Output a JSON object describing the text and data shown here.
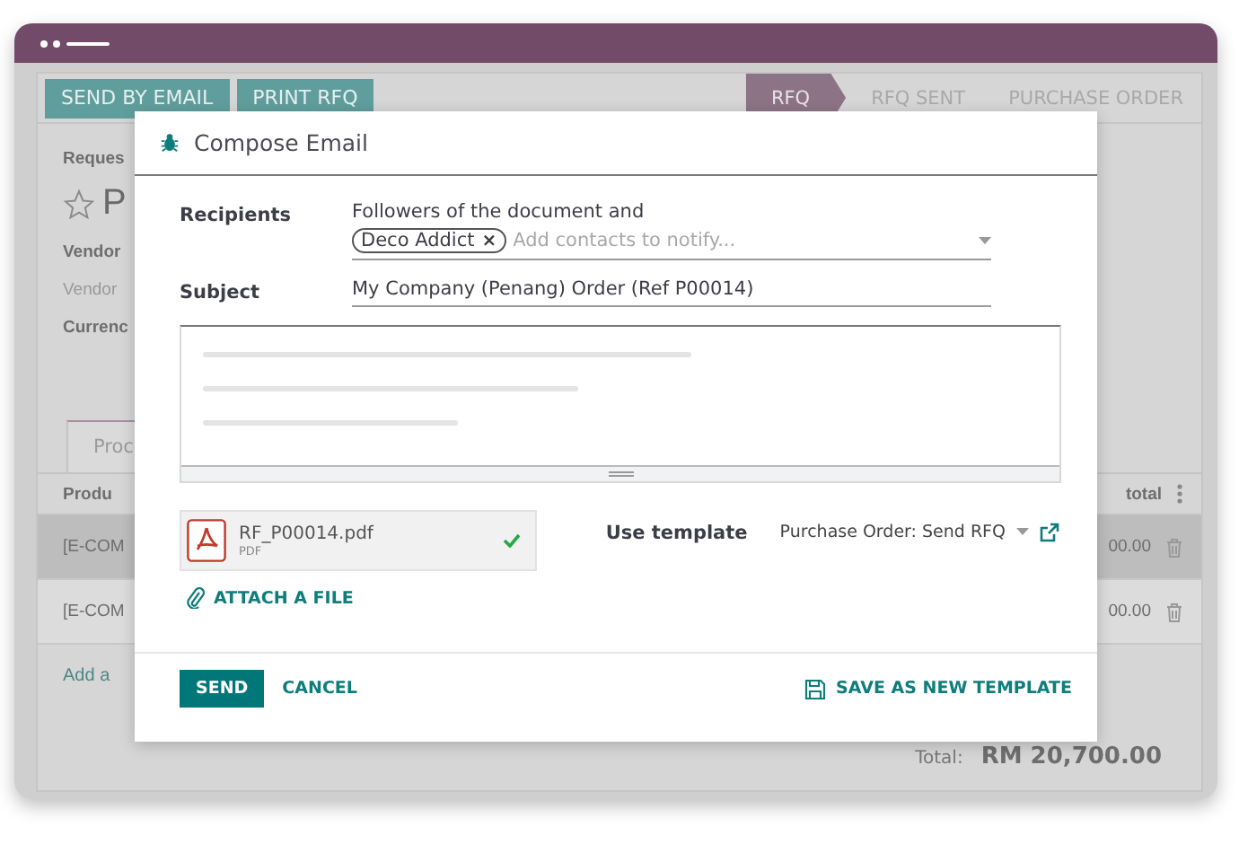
{
  "toolbar": {
    "buttons": [
      "SEND BY EMAIL",
      "PRINT RFQ"
    ]
  },
  "stages": [
    {
      "label": "RFQ",
      "selected": true
    },
    {
      "label": "RFQ SENT",
      "selected": false
    },
    {
      "label": "PURCHASE ORDER",
      "selected": false
    }
  ],
  "form": {
    "caption": "Reques",
    "title": "P",
    "fields": [
      {
        "label": "Vendor",
        "disabled": false
      },
      {
        "label": "Vendor",
        "disabled": true
      },
      {
        "label": "Currenc",
        "disabled": false
      }
    ]
  },
  "tabs": [
    {
      "label": "Proc",
      "selected": true
    }
  ],
  "table": {
    "columns": [
      "Produ",
      "total"
    ],
    "rows": [
      {
        "product": "[E-COM",
        "subtotal": "00.00",
        "highlighted": true
      },
      {
        "product": "[E-COM",
        "subtotal": "00.00",
        "highlighted": false
      }
    ],
    "add_line": "Add a",
    "total_label": "Total:",
    "total_value": "RM 20,700.00"
  },
  "dialog": {
    "title": "Compose Email",
    "recipients": {
      "label": "Recipients",
      "text": "Followers of the document and",
      "tags": [
        {
          "label": "Deco Addict",
          "remove": "×"
        }
      ],
      "placeholder": "Add contacts to notify..."
    },
    "subject": {
      "label": "Subject",
      "value": "My Company (Penang) Order (Ref P00014)"
    },
    "attachments": [
      {
        "name": "RF_P00014.pdf",
        "type": "PDF",
        "uploaded": true
      }
    ],
    "attach_label": "ATTACH A FILE",
    "template": {
      "label": "Use template",
      "value": "Purchase Order: Send RFQ"
    },
    "send": "SEND",
    "cancel": "CANCEL",
    "save_template": "SAVE AS NEW TEMPLATE"
  }
}
